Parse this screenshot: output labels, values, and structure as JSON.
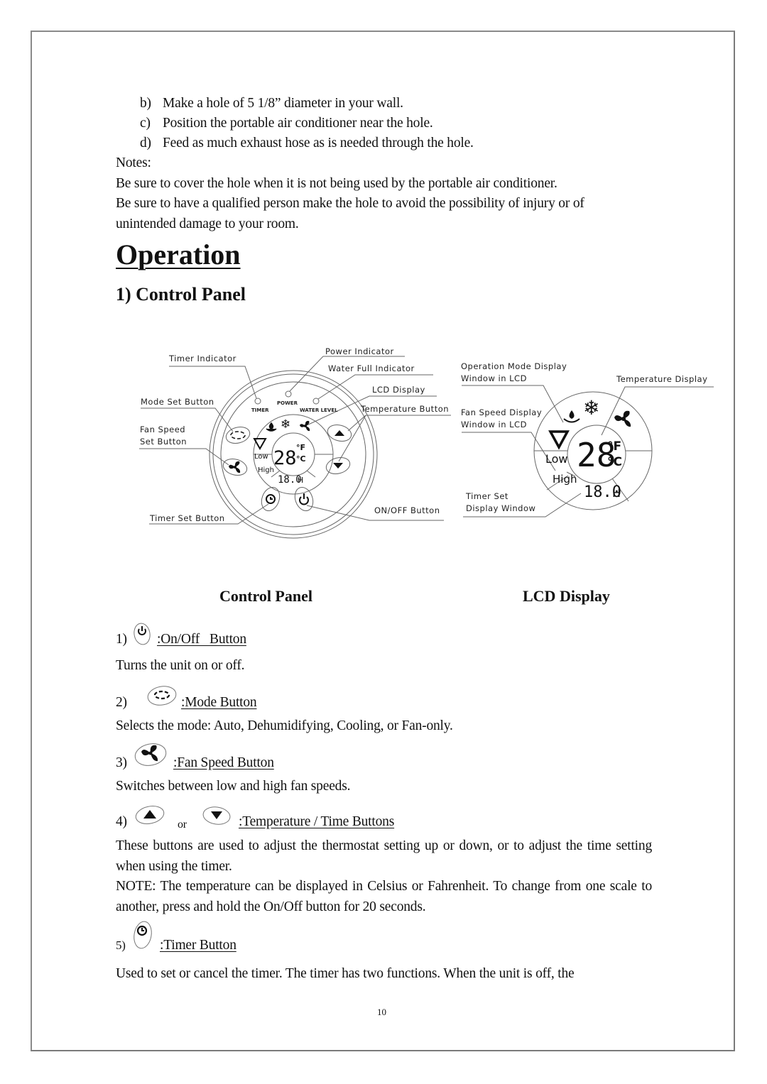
{
  "intro": {
    "steps": [
      {
        "label": "b)",
        "text": "Make a hole of 5 1/8” diameter in your wall."
      },
      {
        "label": "c)",
        "text": "Position the portable air conditioner near the hole."
      },
      {
        "label": "d)",
        "text": "Feed as much exhaust hose as is needed through the hole."
      }
    ],
    "notes_label": "Notes:",
    "notes": [
      "Be sure to cover the hole when it is not being used by the portable air conditioner.",
      "Be sure to have a qualified person make the hole to avoid the possibility of injury or of",
      "unintended damage to your room."
    ]
  },
  "section_title": "Operation",
  "subsection_title": "1) Control Panel",
  "control_panel_diagram": {
    "callouts": {
      "timer_indicator": "Timer Indicator",
      "power_indicator": "Power Indicator",
      "water_full_indicator": "Water Full Indicator",
      "lcd_display": "LCD Display",
      "mode_set_button": "Mode Set Button",
      "temperature_button": "Temperature Button",
      "fan_speed_set_button_line1": "Fan Speed",
      "fan_speed_set_button_line2": "Set Button",
      "timer_set_button": "Timer Set Button",
      "on_off_button": "ON/OFF Button"
    },
    "panel_labels": {
      "timer": "TIMER",
      "power": "POWER",
      "water_level": "WATER LEVEL"
    },
    "caption": "Control Panel"
  },
  "lcd_diagram": {
    "callouts": {
      "operation_mode_line1": "Operation Mode Display",
      "operation_mode_line2": "Window in LCD",
      "temperature_display": "Temperature Display",
      "fan_speed_line1": "Fan Speed Display",
      "fan_speed_line2": "Window in LCD",
      "timer_set_line1": "Timer Set",
      "timer_set_line2": "Display Window"
    },
    "caption": "LCD Display"
  },
  "lcd_readout": {
    "temperature": "28",
    "unit_f": "°F",
    "unit_c": "°C",
    "fan_low": "Low",
    "fan_high": "High",
    "timer": "18.0",
    "timer_unit": "H"
  },
  "buttons": [
    {
      "num": "1)",
      "icon": "power-icon",
      "name": ":On/Off   Button",
      "desc": [
        "Turns the unit on or off."
      ]
    },
    {
      "num": "2)",
      "icon": "mode-icon",
      "name": ":Mode Button",
      "desc": [
        "Selects the mode: Auto, Dehumidifying, Cooling, or Fan-only."
      ]
    },
    {
      "num": "3)",
      "icon": "fan-icon",
      "name": ":Fan Speed Button",
      "desc": [
        "Switches between low and high fan speeds."
      ]
    },
    {
      "num": "4)",
      "icon": "up-down-arrow-icons",
      "or": "or",
      "name": ":Temperature / Time Buttons",
      "desc": [
        "These buttons are used to adjust the thermostat setting up or down, or to adjust the time setting when using the timer.",
        "NOTE: The temperature can be displayed in Celsius or Fahrenheit. To change from one scale to another, press and hold the On/Off button for 20 seconds."
      ]
    },
    {
      "num": "5)",
      "icon": "clock-icon",
      "name": ":Timer Button",
      "desc": [
        "Used to set or cancel the timer. The timer has two functions. When the unit is off, the"
      ]
    }
  ],
  "page_number": "10"
}
